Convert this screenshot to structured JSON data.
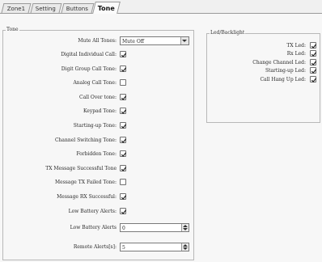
{
  "tabs": [
    {
      "id": "zone1",
      "label": "Zone1"
    },
    {
      "id": "setting",
      "label": "Setting"
    },
    {
      "id": "buttons",
      "label": "Buttons"
    },
    {
      "id": "tone",
      "label": "Tone",
      "active": true
    }
  ],
  "tone_group": {
    "legend": "Tone",
    "mute_all_tones": {
      "label": "Mute All Tones:",
      "value": "Mute Off"
    },
    "checks": [
      {
        "id": "digital-individual-call",
        "label": "Digital Individual Call:",
        "checked": true
      },
      {
        "id": "digit-group-call-tone",
        "label": "Digit Group Call Tone:",
        "checked": true
      },
      {
        "id": "analog-call-tone",
        "label": "Analog Call Tone:",
        "checked": false
      },
      {
        "id": "call-over-tone",
        "label": "Call Over tone:",
        "checked": true
      },
      {
        "id": "keypad-tone",
        "label": "Keypad Tone:",
        "checked": true
      },
      {
        "id": "starting-up-tone",
        "label": "Starting-up Tone:",
        "checked": true
      },
      {
        "id": "channel-switching-tone",
        "label": "Channel Switching Tone:",
        "checked": true
      },
      {
        "id": "forbidden-tone",
        "label": "Forbidden Tone:",
        "checked": true
      },
      {
        "id": "tx-message-successful-tone",
        "label": "TX Message Successful Tone",
        "checked": true
      },
      {
        "id": "message-tx-failed-tone",
        "label": "Message TX Failed Tone:",
        "checked": false
      },
      {
        "id": "message-rx-successful",
        "label": "Message RX Successful:",
        "checked": true
      },
      {
        "id": "low-battery-alerts",
        "label": "Low Battery Alerts:",
        "checked": true
      }
    ],
    "low_battery_alerts_value": {
      "label": "Low Battery Alerts",
      "value": "0"
    },
    "remote_alerts": {
      "label": "Remote Alerts[s]:",
      "value": "5"
    }
  },
  "led_group": {
    "legend": "Led/Backlight",
    "checks": [
      {
        "id": "tx-led",
        "label": "TX Led:",
        "checked": true
      },
      {
        "id": "rx-led",
        "label": "Rx Led:",
        "checked": true
      },
      {
        "id": "change-channel-led",
        "label": "Change Channel Led:",
        "checked": true
      },
      {
        "id": "starting-up-led",
        "label": "Starting-up Led:",
        "checked": true
      },
      {
        "id": "call-hang-up-led",
        "label": "Call Hang Up Led:",
        "checked": true
      }
    ]
  }
}
